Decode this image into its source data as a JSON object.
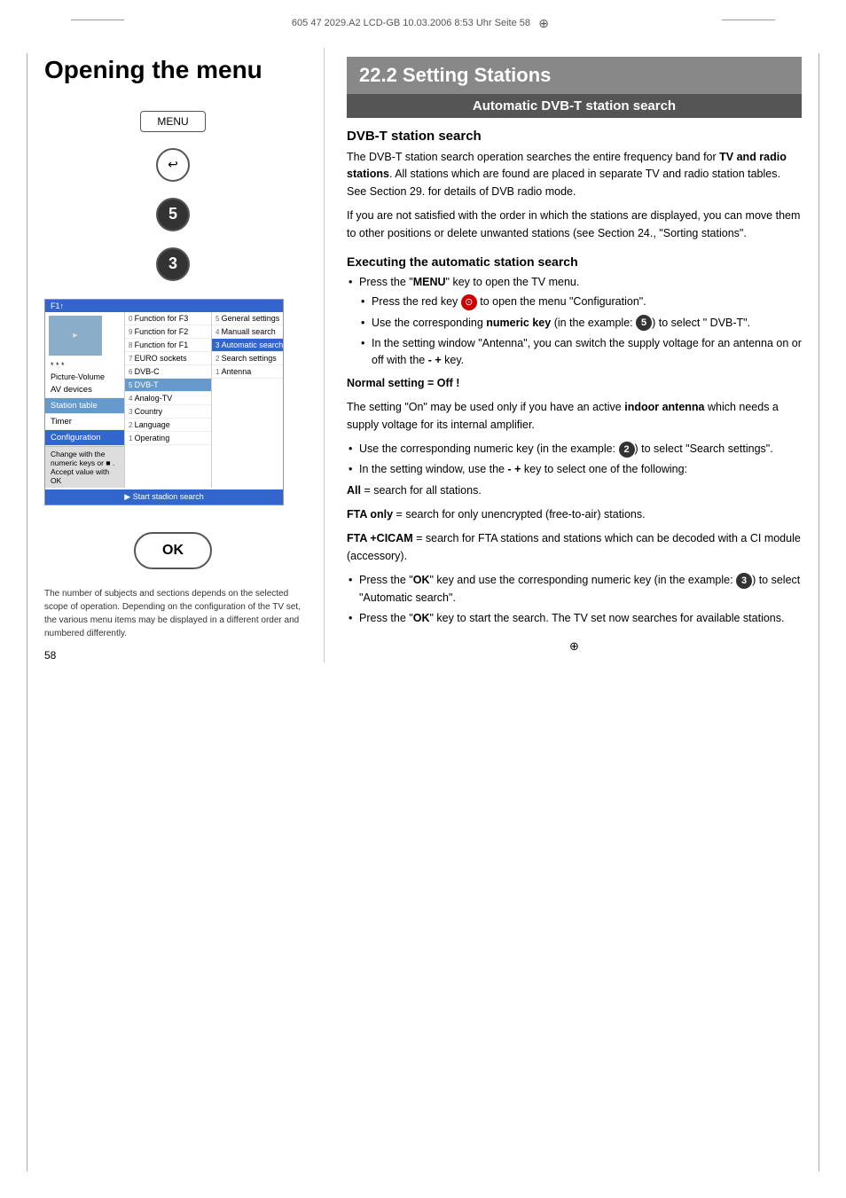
{
  "page": {
    "header_text": "605 47 2029.A2 LCD-GB  10.03.2006  8:53 Uhr  Seite 58",
    "page_number": "58"
  },
  "left": {
    "title": "Opening the menu",
    "menu_label": "MENU",
    "ok_label": "OK",
    "footnote": "The number of subjects and sections depends on the selected scope of operation. Depending on the configuration of the TV set, the various menu items may be displayed in a different order and numbered differently.",
    "tv_menu": {
      "header_left": "F1↑",
      "items_col0": [
        {
          "num": "0",
          "label": "Function for F3"
        },
        {
          "num": "9",
          "label": "Function for F2"
        },
        {
          "num": "8",
          "label": "Function for F1"
        },
        {
          "num": "7",
          "label": "EURO sockets"
        },
        {
          "num": "6",
          "label": "DVB-C"
        },
        {
          "num": "5",
          "label": "DVB-T",
          "selected": true
        },
        {
          "num": "4",
          "label": "Analog-TV"
        },
        {
          "num": "3",
          "label": "Country"
        },
        {
          "num": "2",
          "label": "Language"
        },
        {
          "num": "1",
          "label": "Operating"
        }
      ],
      "left_menu": [
        {
          "label": "Picture-Volume"
        },
        {
          "label": "AV devices"
        },
        {
          "label": "Station table",
          "selected": true
        },
        {
          "label": "Timer"
        },
        {
          "label": "Configuration"
        }
      ],
      "col_center": [
        {
          "num": "5",
          "label": "General settings"
        },
        {
          "num": "4",
          "label": "Manuall search"
        },
        {
          "num": "3",
          "label": "Automatic search",
          "selected": true
        },
        {
          "num": "2",
          "label": "Search settings"
        },
        {
          "num": "1",
          "label": "Antenna"
        }
      ],
      "bottom_hint": "Change with the numeric keys or ■ . Accept value with OK",
      "start_search": "▶ Start stadion search"
    }
  },
  "right": {
    "section_number": "22.2 Setting Stations",
    "sub_title": "Automatic DVB-T station search",
    "dvbt_heading": "DVB-T station search",
    "dvbt_para1": "The DVB-T station search operation searches the entire frequency band for TV and radio stations. All stations which are found are placed in separate TV and radio station tables. See Section 29. for details of DVB radio mode.",
    "dvbt_para2": "If you are not satisfied with the order in which the stations are displayed, you can move them to other positions or delete unwanted stations (see Section 24., \"Sorting stations\".",
    "exec_heading": "Executing the automatic station search",
    "steps": [
      {
        "text": "Press the \"MENU\" key to open the TV menu.",
        "sub": [
          "Press the red key ⊙ to open the menu \"Configuration\".",
          "Use the corresponding numeric key (in the example: ⑤) to select \" DVB-T\".",
          "In the setting window \"Antenna\", you can switch the supply voltage for an antenna on or off with the - + key."
        ]
      }
    ],
    "normal_setting": "Normal setting = Off !",
    "normal_para": "The setting \"On\" may be used only if you have an active indoor antenna which needs a supply voltage for its internal amplifier.",
    "steps2": [
      "Use the corresponding numeric key (in the example: ②) to select \"Search settings\".",
      "In the setting window, use the - + key to select one of the following:"
    ],
    "all_label": "All",
    "all_desc": "= search for all stations.",
    "fta_label": "FTA only",
    "fta_desc": "= search for only unencrypted (free-to-air) stations.",
    "ftacicam_label": "FTA +CICAM",
    "ftacicam_desc": "= search for FTA stations and stations which can be decoded with a CI module (accessory).",
    "steps3": [
      "Press the \"OK\" key and use the corresponding numeric key (in the example: ③) to select \"Automatic search\".",
      "Press the \"OK\" key to start the search. The TV set now searches for available stations."
    ]
  }
}
